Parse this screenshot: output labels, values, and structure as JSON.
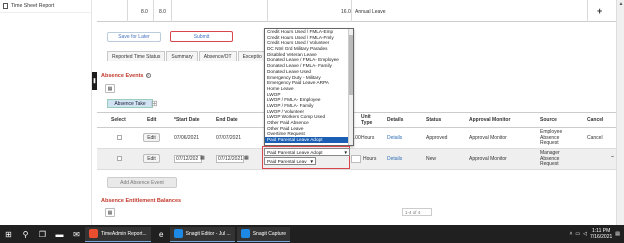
{
  "sidebar": {
    "items": [
      {
        "label": "Time Sheet Report"
      }
    ]
  },
  "top_grid": {
    "val1": "8.0",
    "val2": "8.0",
    "val3": "16.0",
    "annual_leave": "Annual Leave"
  },
  "actions": {
    "save_later": "Save for Later",
    "submit": "Submit"
  },
  "tabs": [
    {
      "label": "Reported Time Status"
    },
    {
      "label": "Summary"
    },
    {
      "label": "Absence/OT"
    },
    {
      "label": "Exceptio"
    }
  ],
  "absence_events": {
    "title": "Absence Events",
    "tab_label": "Absence Take",
    "columns": {
      "select": "Select",
      "edit": "Edit",
      "start": "*Start Date",
      "end": "End Date",
      "unit_type": "Unit Type",
      "details": "Details",
      "status": "Status",
      "approval_monitor": "Approval Monitor",
      "source": "Source",
      "cancel": "Cancel"
    },
    "rows": [
      {
        "edit": "Edit",
        "start": "07/06/2021",
        "end": "07/07/2021",
        "amount": "3.00",
        "unit": "Hours",
        "details": "Details",
        "status": "Approved",
        "monitor": "Approval Monitor",
        "source": "Employee Absence Request",
        "cancel": "Cancel"
      },
      {
        "edit": "Edit",
        "start": "07/12/202",
        "end": "07/12/2021",
        "unit": "Hours",
        "details": "Details",
        "status": "New",
        "monitor": "Approval Monitor",
        "source": "Manager Absence Request"
      }
    ],
    "add_button": "Add Absence Event"
  },
  "dropdown": {
    "options": [
      "Credit Hours Used / FMLA-Emp",
      "Credit Hours Used / FMLA-Fmly",
      "Credit Hours Used / Volunteer",
      "DC Ntnl Grd Military Parades",
      "Disabled Veteran Leave",
      "Donated Leave / FMLA- Employee",
      "Donated Leave / FMLA- Family",
      "Donated Leave Used",
      "Emergency Duty - Military",
      "Emergency Paid Leave ARPA",
      "Home Leave",
      "LWOP",
      "LWOP / FMLA- Employee",
      "LWOP / FMLA- Family",
      "LWOP / Volunteer",
      "LWOP Workers Comp Used",
      "Other Paid Absence",
      "Other Paid Leave",
      "Overtime Request",
      "Paid Parental Leave Adopt"
    ],
    "selected": "Paid Parental Leave Adopt",
    "second_value": "Paid Parental Leav"
  },
  "entitlement": {
    "title": "Absence Entitlement Balances",
    "pager": "1-4 of 4"
  },
  "taskbar": {
    "apps": [
      {
        "label": "TimeAdmin Report...",
        "color": "#e94f2e"
      },
      {
        "label": "Snagit Editor - Jul ...",
        "color": "#1e88e5"
      },
      {
        "label": "Snagit Capture",
        "color": "#1e88e5"
      }
    ],
    "time": "1:11 PM",
    "date": "7/16/2021"
  }
}
